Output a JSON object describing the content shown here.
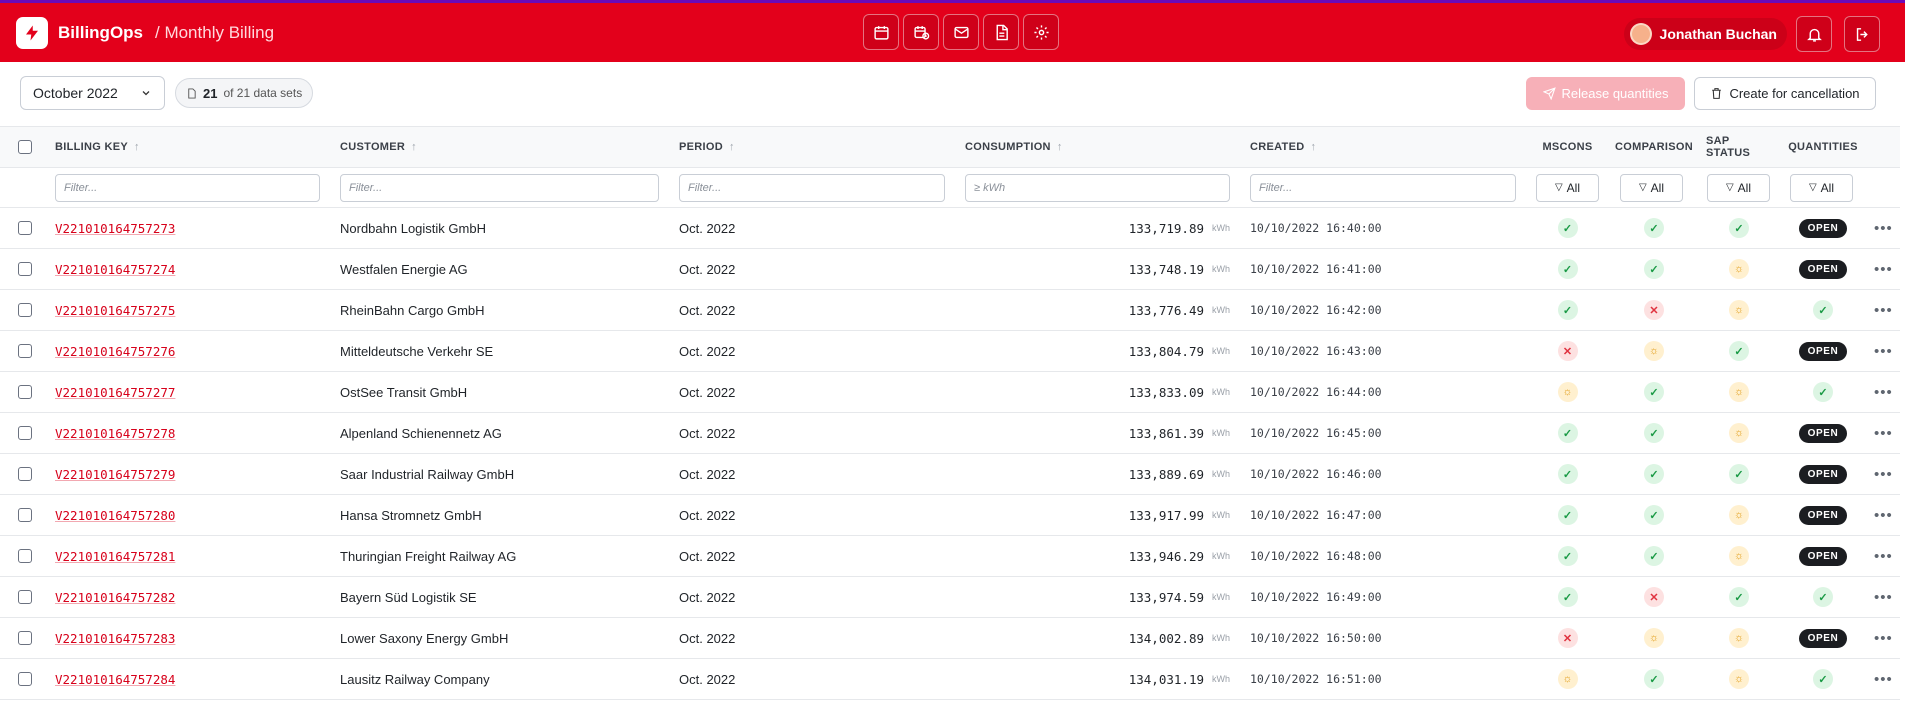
{
  "header": {
    "app_name": "BillingOps",
    "breadcrumb": "/ Monthly Billing",
    "user_name": "Jonathan Buchan"
  },
  "toolbar": {
    "month": "October 2022",
    "dataset_count": "21",
    "dataset_total": "of 21 data sets",
    "release_label": "Release quantities",
    "cancel_label": "Create for cancellation"
  },
  "columns": {
    "billing_key": "BILLING KEY",
    "customer": "CUSTOMER",
    "period": "PERIOD",
    "consumption": "CONSUMPTION",
    "created": "CREATED",
    "mscons": "MSCONS",
    "comparison": "COMPARISON",
    "sap_status": "SAP STATUS",
    "quantities": "QUANTITIES"
  },
  "filters": {
    "billing_key_placeholder": "Filter...",
    "customer_placeholder": "Filter...",
    "period_placeholder": "Filter...",
    "consumption_placeholder": "≥ kWh",
    "created_placeholder": "Filter...",
    "all_label": "All"
  },
  "unit": "kWh",
  "status_colors": {
    "ok": "#1a9a45",
    "error": "#e0323f",
    "pending": "#e09a12",
    "brand": "#e3001b"
  },
  "rows": [
    {
      "key": "V221010164757273",
      "customer": "Nordbahn Logistik GmbH",
      "period": "Oct. 2022",
      "consumption": "133,719.89",
      "created": "10/10/2022 16:40:00",
      "mscons": "ok",
      "comparison": "ok",
      "sap": "ok",
      "quantities": "OPEN"
    },
    {
      "key": "V221010164757274",
      "customer": "Westfalen Energie AG",
      "period": "Oct. 2022",
      "consumption": "133,748.19",
      "created": "10/10/2022 16:41:00",
      "mscons": "ok",
      "comparison": "ok",
      "sap": "pending",
      "quantities": "OPEN"
    },
    {
      "key": "V221010164757275",
      "customer": "RheinBahn Cargo GmbH",
      "period": "Oct. 2022",
      "consumption": "133,776.49",
      "created": "10/10/2022 16:42:00",
      "mscons": "ok",
      "comparison": "error",
      "sap": "pending",
      "quantities": "ok"
    },
    {
      "key": "V221010164757276",
      "customer": "Mitteldeutsche Verkehr SE",
      "period": "Oct. 2022",
      "consumption": "133,804.79",
      "created": "10/10/2022 16:43:00",
      "mscons": "error",
      "comparison": "pending",
      "sap": "ok",
      "quantities": "OPEN"
    },
    {
      "key": "V221010164757277",
      "customer": "OstSee Transit GmbH",
      "period": "Oct. 2022",
      "consumption": "133,833.09",
      "created": "10/10/2022 16:44:00",
      "mscons": "pending",
      "comparison": "ok",
      "sap": "pending",
      "quantities": "ok"
    },
    {
      "key": "V221010164757278",
      "customer": "Alpenland Schienennetz AG",
      "period": "Oct. 2022",
      "consumption": "133,861.39",
      "created": "10/10/2022 16:45:00",
      "mscons": "ok",
      "comparison": "ok",
      "sap": "pending",
      "quantities": "OPEN"
    },
    {
      "key": "V221010164757279",
      "customer": "Saar Industrial Railway GmbH",
      "period": "Oct. 2022",
      "consumption": "133,889.69",
      "created": "10/10/2022 16:46:00",
      "mscons": "ok",
      "comparison": "ok",
      "sap": "ok",
      "quantities": "OPEN"
    },
    {
      "key": "V221010164757280",
      "customer": "Hansa Stromnetz GmbH",
      "period": "Oct. 2022",
      "consumption": "133,917.99",
      "created": "10/10/2022 16:47:00",
      "mscons": "ok",
      "comparison": "ok",
      "sap": "pending",
      "quantities": "OPEN"
    },
    {
      "key": "V221010164757281",
      "customer": "Thuringian Freight Railway AG",
      "period": "Oct. 2022",
      "consumption": "133,946.29",
      "created": "10/10/2022 16:48:00",
      "mscons": "ok",
      "comparison": "ok",
      "sap": "pending",
      "quantities": "OPEN"
    },
    {
      "key": "V221010164757282",
      "customer": "Bayern Süd Logistik SE",
      "period": "Oct. 2022",
      "consumption": "133,974.59",
      "created": "10/10/2022 16:49:00",
      "mscons": "ok",
      "comparison": "error",
      "sap": "ok",
      "quantities": "ok"
    },
    {
      "key": "V221010164757283",
      "customer": "Lower Saxony Energy GmbH",
      "period": "Oct. 2022",
      "consumption": "134,002.89",
      "created": "10/10/2022 16:50:00",
      "mscons": "error",
      "comparison": "pending",
      "sap": "pending",
      "quantities": "OPEN"
    },
    {
      "key": "V221010164757284",
      "customer": "Lausitz Railway Company",
      "period": "Oct. 2022",
      "consumption": "134,031.19",
      "created": "10/10/2022 16:51:00",
      "mscons": "pending",
      "comparison": "ok",
      "sap": "pending",
      "quantities": "ok"
    }
  ]
}
